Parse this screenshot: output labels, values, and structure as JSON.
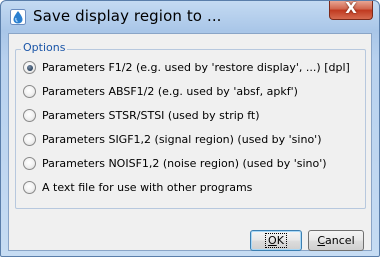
{
  "window": {
    "title": "Save display region to ...",
    "close_glyph": "X"
  },
  "icons": {
    "app": "topspin-app-icon",
    "close": "close-icon"
  },
  "group": {
    "legend": "Options"
  },
  "options": [
    {
      "label": "Parameters F1/2 (e.g. used by 'restore display', ...) [dpl]",
      "checked": true
    },
    {
      "label": "Parameters ABSF1/2 (e.g. used by 'absf, apkf')",
      "checked": false
    },
    {
      "label": "Parameters STSR/STSI (used by strip ft)",
      "checked": false
    },
    {
      "label": "Parameters SIGF1,2 (signal region) (used by 'sino')",
      "checked": false
    },
    {
      "label": "Parameters NOISF1,2 (noise region) (used by 'sino')",
      "checked": false
    },
    {
      "label": "A text file for use with other programs",
      "checked": false
    }
  ],
  "buttons": {
    "ok": {
      "accel": "O",
      "rest": "K"
    },
    "cancel": {
      "accel": "C",
      "rest": "ancel"
    }
  },
  "colors": {
    "legend": "#1a55a8",
    "close": "#c0391f",
    "title_bar": "#a9c6e8"
  }
}
